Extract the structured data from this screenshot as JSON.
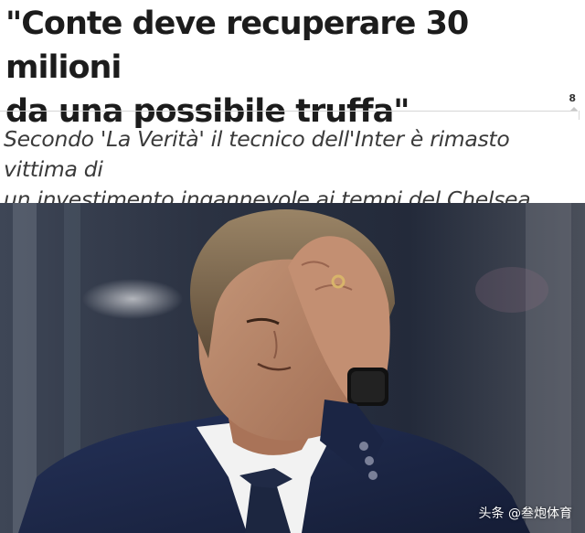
{
  "article": {
    "headline_line1": "\"Conte deve recuperare 30 milioni",
    "headline_line2": "da una possibile truffa\"",
    "share_count": "8",
    "subtitle_line1": "Secondo 'La Verità' il tecnico dell'Inter è rimasto vittima di",
    "subtitle_line2": "un investimento ingannevole ai tempi del Chelsea"
  },
  "photo": {
    "subject": "man in navy suit covering forehead with hand",
    "watermark": "头条 @叁炮体育"
  },
  "colors": {
    "headline": "#1c1c1c",
    "subtitle": "#3a3a3a",
    "suit": "#1d2a4a",
    "background_dark": "#2a3140"
  }
}
